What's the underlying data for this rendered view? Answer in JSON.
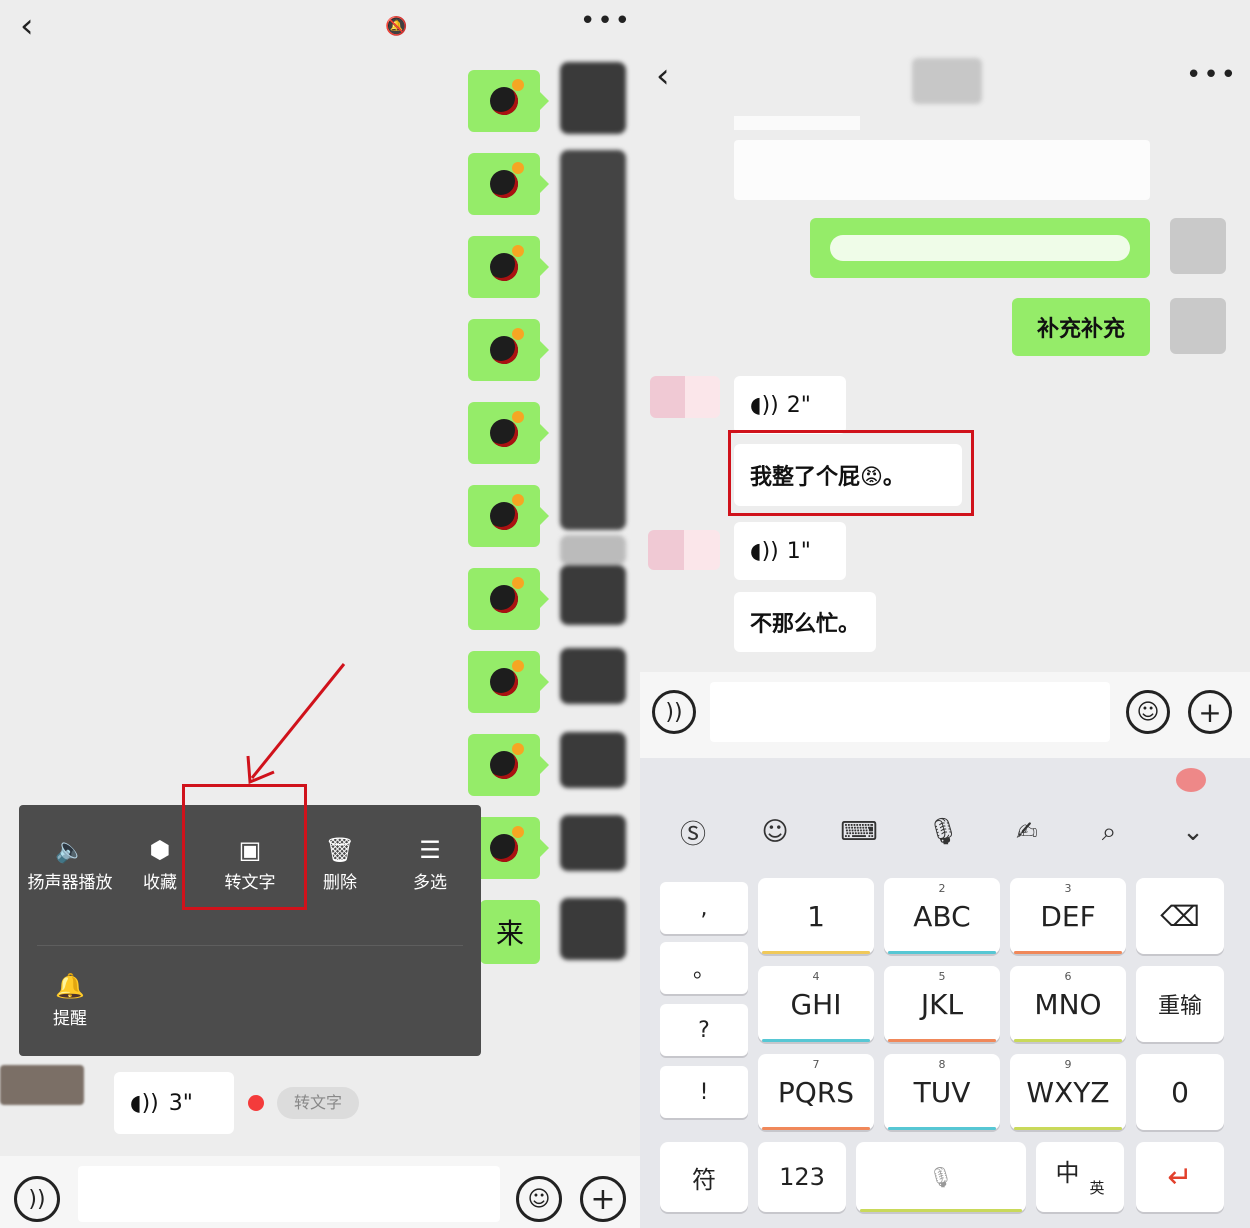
{
  "left": {
    "context_menu": {
      "items": [
        {
          "label": "扬声器播放",
          "icon": "speaker-icon"
        },
        {
          "label": "收藏",
          "icon": "cube-icon"
        },
        {
          "label": "转文字",
          "icon": "text-doc-icon"
        },
        {
          "label": "删除",
          "icon": "trash-icon"
        },
        {
          "label": "多选",
          "icon": "list-check-icon"
        }
      ],
      "remind_label": "提醒"
    },
    "last_bubble_text": "来",
    "voice_message": {
      "duration": "3\""
    },
    "convert_pill": "转文字"
  },
  "right": {
    "green_message_2": "补充补充",
    "voice_1": {
      "duration": "2\""
    },
    "transcription_1": "我整了个屁😡。",
    "voice_2": {
      "duration": "1\""
    },
    "transcription_2": "不那么忙。",
    "keyboard": {
      "side_keys": [
        ",",
        "。",
        "?",
        "!"
      ],
      "rows": [
        [
          {
            "label": "1",
            "num": ""
          },
          {
            "label": "ABC",
            "num": "2"
          },
          {
            "label": "DEF",
            "num": "3"
          }
        ],
        [
          {
            "label": "GHI",
            "num": "4"
          },
          {
            "label": "JKL",
            "num": "5"
          },
          {
            "label": "MNO",
            "num": "6"
          }
        ],
        [
          {
            "label": "PQRS",
            "num": "7"
          },
          {
            "label": "TUV",
            "num": "8"
          },
          {
            "label": "WXYZ",
            "num": "9"
          }
        ]
      ],
      "reenter_label": "重输",
      "zero_label": "0",
      "symbol_label": "符",
      "numeric_label": "123",
      "lang_label_main": "中",
      "lang_label_sub": "英"
    }
  },
  "colors": {
    "green_bubble": "#95ec69",
    "highlight_red": "#d0121b",
    "menu_bg": "#4c4c4c"
  }
}
